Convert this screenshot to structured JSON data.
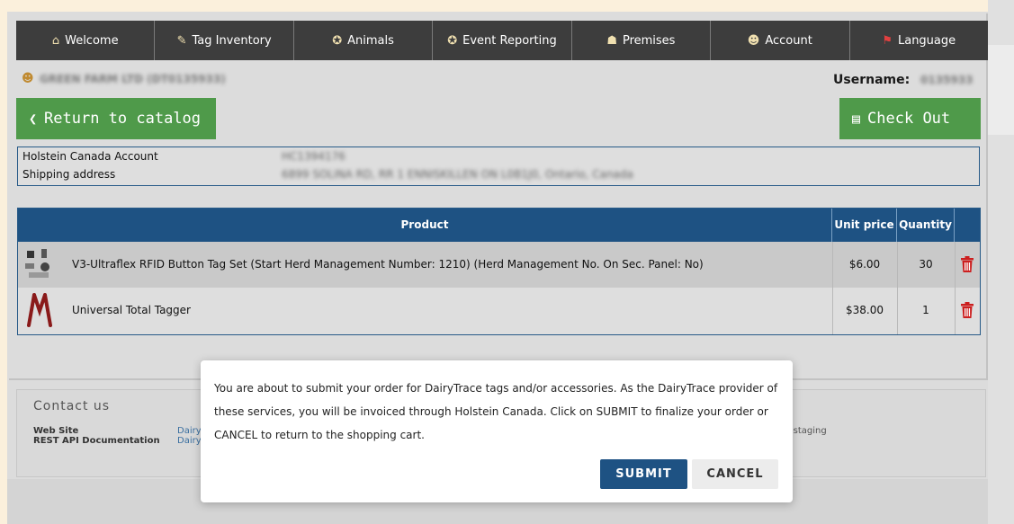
{
  "nav": {
    "items": [
      {
        "label": "Welcome",
        "icon": "home-icon"
      },
      {
        "label": "Tag Inventory",
        "icon": "pencil-icon"
      },
      {
        "label": "Animals",
        "icon": "animal-icon"
      },
      {
        "label": "Event Reporting",
        "icon": "animal-icon"
      },
      {
        "label": "Premises",
        "icon": "farm-icon"
      },
      {
        "label": "Account",
        "icon": "user-icon"
      },
      {
        "label": "Language",
        "icon": "flag-icon"
      }
    ]
  },
  "user": {
    "farm_name": "GREEN FARM LTD (DT0135933)",
    "username_label": "Username:",
    "username_value": "0135933"
  },
  "buttons": {
    "return_label": "Return to catalog",
    "checkout_label": "Check Out"
  },
  "account_info": {
    "account_label": "Holstein Canada Account",
    "account_value": "HC1394176",
    "shipping_label": "Shipping address",
    "shipping_value": "6899 SOLINA RD, RR 1 ENNISKILLEN ON L0B1J0, Ontario, Canada"
  },
  "table": {
    "headers": {
      "product": "Product",
      "unit_price": "Unit price",
      "quantity": "Quantity"
    },
    "rows": [
      {
        "product": "V3-Ultraflex RFID Button Tag Set (Start Herd Management Number: 1210) (Herd Management No. On Sec. Panel: No)",
        "unit_price": "$6.00",
        "quantity": "30"
      },
      {
        "product": "Universal Total Tagger",
        "unit_price": "$38.00",
        "quantity": "1"
      }
    ]
  },
  "contact": {
    "heading": "Contact us",
    "web_site_label": "Web Site",
    "rest_api_label": "REST API Documentation",
    "web_site_value": "Dairy",
    "rest_api_value": "Dairy",
    "env_value": "cc-staging"
  },
  "modal": {
    "message": "You are about to submit your order for DairyTrace tags and/or accessories. As the DairyTrace provider of these services, you will be invoiced through Holstein Canada. Click on SUBMIT to finalize your order or CANCEL to return to the shopping cart.",
    "submit_label": "SUBMIT",
    "cancel_label": "CANCEL"
  },
  "colors": {
    "nav_bg": "#3d3d3d",
    "green_button": "#4f9a4a",
    "table_header": "#1e5283",
    "submit_button": "#1e5283",
    "trash": "#cc1f1f"
  }
}
